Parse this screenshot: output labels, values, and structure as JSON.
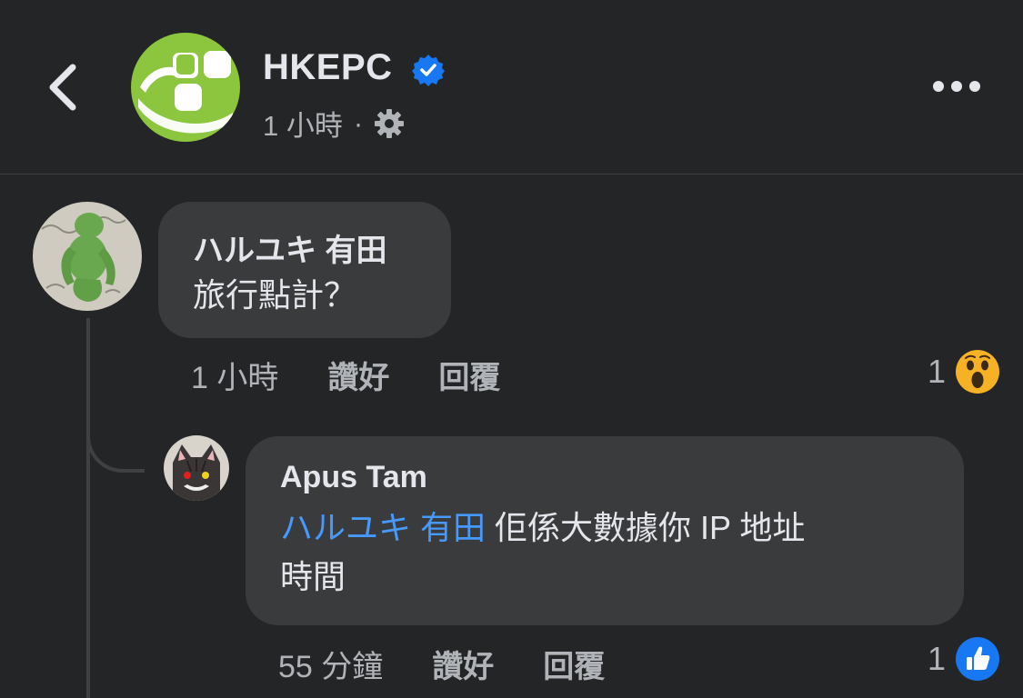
{
  "header": {
    "page_name": "HKEPC",
    "time": "1 小時",
    "separator": "·"
  },
  "comments": [
    {
      "author": "ハルユキ 有田",
      "text": "旅行點計？",
      "time": "1 小時",
      "like_label": "讚好",
      "reply_label": "回覆",
      "reaction_count": "1",
      "reaction_icon": "wow-emoji-icon"
    },
    {
      "author": "Apus Tam",
      "mention": "ハルユキ 有田",
      "text_line1": " 佢係大數據你 IP 地址",
      "text_line2": "時間",
      "time": "55 分鐘",
      "like_label": "讚好",
      "reply_label": "回覆",
      "reaction_count": "1",
      "reaction_icon": "like-thumb-icon"
    }
  ],
  "colors": {
    "background": "#242526",
    "bubble": "#3a3b3c",
    "mention": "#4599ff",
    "verified": "#1877f2",
    "logo_green": "#8cc63f",
    "like_blue": "#1877f2"
  }
}
